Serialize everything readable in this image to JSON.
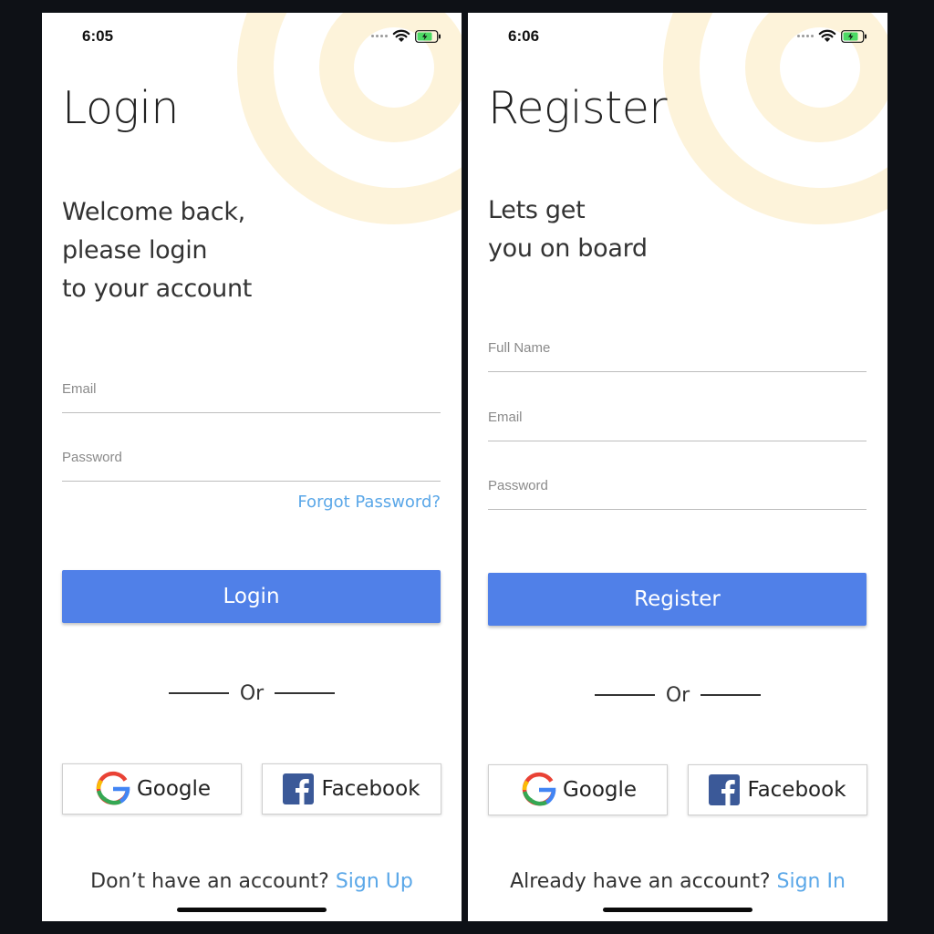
{
  "colors": {
    "background": "#0e1116",
    "primary_button": "#5080e8",
    "link": "#5aa7e8",
    "decoration": "#fdf3da"
  },
  "icons": [
    "wifi-icon",
    "battery-charging-icon",
    "google-logo-icon",
    "facebook-logo-icon"
  ],
  "login_screen": {
    "status_time": "6:05",
    "title": "Login",
    "subtitle": "Welcome back,\nplease login\nto your account",
    "fields": [
      {
        "label": "Email",
        "value": ""
      },
      {
        "label": "Password",
        "value": ""
      }
    ],
    "forgot_password": "Forgot Password?",
    "primary_button": "Login",
    "divider_text": "Or",
    "google_label": "Google",
    "facebook_label": "Facebook",
    "footer_text": "Don’t have an account?",
    "footer_link": "Sign Up"
  },
  "register_screen": {
    "status_time": "6:06",
    "title": "Register",
    "subtitle": "Lets get\nyou on board",
    "fields": [
      {
        "label": "Full Name",
        "value": ""
      },
      {
        "label": "Email",
        "value": ""
      },
      {
        "label": "Password",
        "value": ""
      }
    ],
    "primary_button": "Register",
    "divider_text": "Or",
    "google_label": "Google",
    "facebook_label": "Facebook",
    "footer_text": "Already have an account?",
    "footer_link": "Sign In"
  }
}
